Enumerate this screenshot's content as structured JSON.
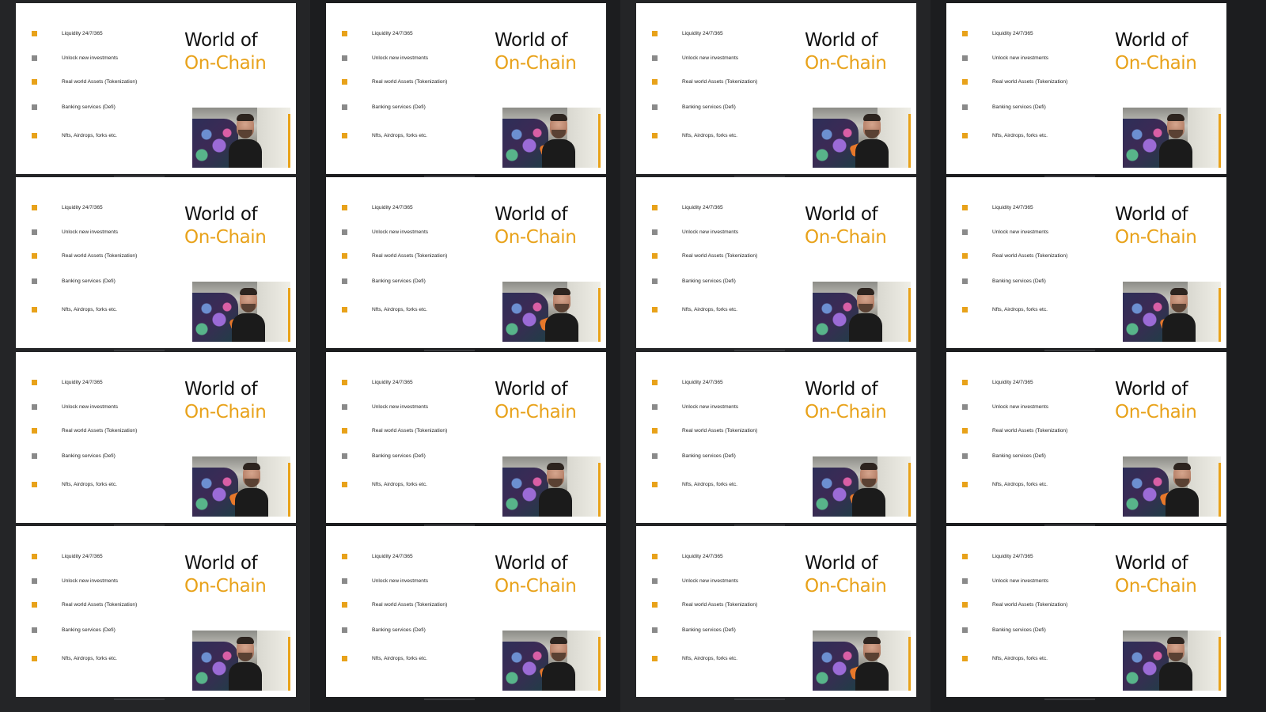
{
  "background": "#1c1d1f",
  "column_bg": "#242527",
  "colors": {
    "accent": "#e8a21a",
    "bullet_gray": "#8a8a8a",
    "title_dark": "#111111",
    "slide_bg": "#ffffff"
  },
  "slide_template": {
    "bullets": [
      {
        "text": "Liquidity 24/7/365",
        "color": "accent"
      },
      {
        "text": "Unlock new investments",
        "color": "bullet_gray"
      },
      {
        "text": "Real world Assets (Tokenization)",
        "color": "accent"
      },
      {
        "text": "Banking services (Defi)",
        "color": "bullet_gray"
      },
      {
        "text": "Nfts, Airdrops, forks etc.",
        "color": "accent"
      }
    ],
    "title_line1": "World of",
    "title_line2": "On-Chain",
    "video_icon": "presenter-webcam",
    "watermark": ""
  },
  "grid": {
    "rows": 4,
    "cols": 4,
    "count": 16
  }
}
